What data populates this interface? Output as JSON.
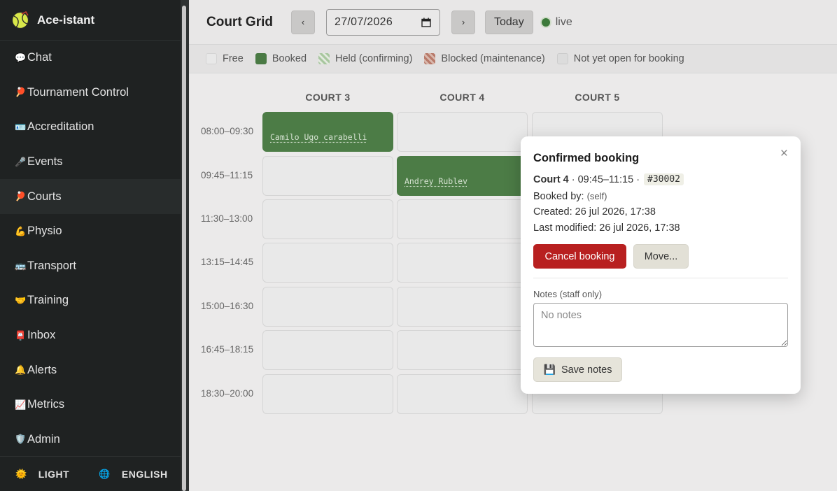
{
  "app": {
    "name": "Ace-istant"
  },
  "sidebar": {
    "items": [
      {
        "label": "Chat",
        "icon": "speech-bubble-icon",
        "emoji": "💬"
      },
      {
        "label": "Tournament Control",
        "icon": "racket-icon",
        "emoji": "🏓"
      },
      {
        "label": "Accreditation",
        "icon": "id-card-icon",
        "emoji": "🪪"
      },
      {
        "label": "Events",
        "icon": "microphone-icon",
        "emoji": "🎤"
      },
      {
        "label": "Courts",
        "icon": "racket-icon",
        "emoji": "🏓"
      },
      {
        "label": "Physio",
        "icon": "flexed-muscle-icon",
        "emoji": "💪"
      },
      {
        "label": "Transport",
        "icon": "bus-icon",
        "emoji": "🚌"
      },
      {
        "label": "Training",
        "icon": "handshake-icon",
        "emoji": "🤝"
      },
      {
        "label": "Inbox",
        "icon": "mailbox-icon",
        "emoji": "📮"
      },
      {
        "label": "Alerts",
        "icon": "bell-icon",
        "emoji": "🔔"
      },
      {
        "label": "Metrics",
        "icon": "chart-icon",
        "emoji": "📈"
      },
      {
        "label": "Admin",
        "icon": "shield-icon",
        "emoji": "🛡️"
      }
    ],
    "active": "Courts",
    "footer": {
      "theme_label": "LIGHT",
      "language_label": "ENGLISH"
    }
  },
  "topbar": {
    "title": "Court Grid",
    "prev": "‹",
    "next": "›",
    "date_value": "27/07/2026",
    "today_label": "Today",
    "live_label": "live",
    "live_color": "#3c7a3a"
  },
  "legend": [
    {
      "label": "Free"
    },
    {
      "label": "Booked",
      "color": "#4a7a44"
    },
    {
      "label": "Held (confirming)"
    },
    {
      "label": "Blocked (maintenance)"
    },
    {
      "label": "Not yet open for booking"
    }
  ],
  "grid": {
    "courts": [
      "COURT 3",
      "COURT 4",
      "COURT 5"
    ],
    "times": [
      "08:00–09:30",
      "09:45–11:15",
      "11:30–13:00",
      "13:15–14:45",
      "15:00–16:30",
      "16:45–18:15",
      "18:30–20:00"
    ],
    "bookings": [
      {
        "court": 0,
        "slot": 0,
        "player": "Camilo Ugo carabelli"
      },
      {
        "court": 1,
        "slot": 1,
        "player": "Andrey Rublev"
      }
    ]
  },
  "modal": {
    "title": "Confirmed booking",
    "court": "Court 4",
    "time": "· 09:45–11:15 ·",
    "booking_id": "#30002",
    "booked_by_label": "Booked by:",
    "booked_by_value": "(self)",
    "created": "Created: 26 jul 2026, 17:38",
    "modified": "Last modified: 26 jul 2026, 17:38",
    "cancel_label": "Cancel booking",
    "move_label": "Move...",
    "notes_label": "Notes (staff only)",
    "notes_placeholder": "No notes",
    "save_label": "Save notes",
    "close": "×"
  }
}
